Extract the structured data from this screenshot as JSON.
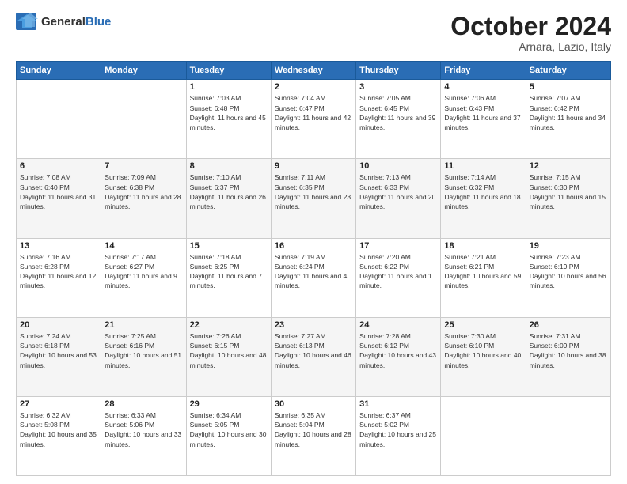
{
  "logo": {
    "line1": "General",
    "line2": "Blue"
  },
  "title": "October 2024",
  "subtitle": "Arnara, Lazio, Italy",
  "days_of_week": [
    "Sunday",
    "Monday",
    "Tuesday",
    "Wednesday",
    "Thursday",
    "Friday",
    "Saturday"
  ],
  "weeks": [
    [
      {
        "day": "",
        "info": ""
      },
      {
        "day": "",
        "info": ""
      },
      {
        "day": "1",
        "info": "Sunrise: 7:03 AM\nSunset: 6:48 PM\nDaylight: 11 hours and 45 minutes."
      },
      {
        "day": "2",
        "info": "Sunrise: 7:04 AM\nSunset: 6:47 PM\nDaylight: 11 hours and 42 minutes."
      },
      {
        "day": "3",
        "info": "Sunrise: 7:05 AM\nSunset: 6:45 PM\nDaylight: 11 hours and 39 minutes."
      },
      {
        "day": "4",
        "info": "Sunrise: 7:06 AM\nSunset: 6:43 PM\nDaylight: 11 hours and 37 minutes."
      },
      {
        "day": "5",
        "info": "Sunrise: 7:07 AM\nSunset: 6:42 PM\nDaylight: 11 hours and 34 minutes."
      }
    ],
    [
      {
        "day": "6",
        "info": "Sunrise: 7:08 AM\nSunset: 6:40 PM\nDaylight: 11 hours and 31 minutes."
      },
      {
        "day": "7",
        "info": "Sunrise: 7:09 AM\nSunset: 6:38 PM\nDaylight: 11 hours and 28 minutes."
      },
      {
        "day": "8",
        "info": "Sunrise: 7:10 AM\nSunset: 6:37 PM\nDaylight: 11 hours and 26 minutes."
      },
      {
        "day": "9",
        "info": "Sunrise: 7:11 AM\nSunset: 6:35 PM\nDaylight: 11 hours and 23 minutes."
      },
      {
        "day": "10",
        "info": "Sunrise: 7:13 AM\nSunset: 6:33 PM\nDaylight: 11 hours and 20 minutes."
      },
      {
        "day": "11",
        "info": "Sunrise: 7:14 AM\nSunset: 6:32 PM\nDaylight: 11 hours and 18 minutes."
      },
      {
        "day": "12",
        "info": "Sunrise: 7:15 AM\nSunset: 6:30 PM\nDaylight: 11 hours and 15 minutes."
      }
    ],
    [
      {
        "day": "13",
        "info": "Sunrise: 7:16 AM\nSunset: 6:28 PM\nDaylight: 11 hours and 12 minutes."
      },
      {
        "day": "14",
        "info": "Sunrise: 7:17 AM\nSunset: 6:27 PM\nDaylight: 11 hours and 9 minutes."
      },
      {
        "day": "15",
        "info": "Sunrise: 7:18 AM\nSunset: 6:25 PM\nDaylight: 11 hours and 7 minutes."
      },
      {
        "day": "16",
        "info": "Sunrise: 7:19 AM\nSunset: 6:24 PM\nDaylight: 11 hours and 4 minutes."
      },
      {
        "day": "17",
        "info": "Sunrise: 7:20 AM\nSunset: 6:22 PM\nDaylight: 11 hours and 1 minute."
      },
      {
        "day": "18",
        "info": "Sunrise: 7:21 AM\nSunset: 6:21 PM\nDaylight: 10 hours and 59 minutes."
      },
      {
        "day": "19",
        "info": "Sunrise: 7:23 AM\nSunset: 6:19 PM\nDaylight: 10 hours and 56 minutes."
      }
    ],
    [
      {
        "day": "20",
        "info": "Sunrise: 7:24 AM\nSunset: 6:18 PM\nDaylight: 10 hours and 53 minutes."
      },
      {
        "day": "21",
        "info": "Sunrise: 7:25 AM\nSunset: 6:16 PM\nDaylight: 10 hours and 51 minutes."
      },
      {
        "day": "22",
        "info": "Sunrise: 7:26 AM\nSunset: 6:15 PM\nDaylight: 10 hours and 48 minutes."
      },
      {
        "day": "23",
        "info": "Sunrise: 7:27 AM\nSunset: 6:13 PM\nDaylight: 10 hours and 46 minutes."
      },
      {
        "day": "24",
        "info": "Sunrise: 7:28 AM\nSunset: 6:12 PM\nDaylight: 10 hours and 43 minutes."
      },
      {
        "day": "25",
        "info": "Sunrise: 7:30 AM\nSunset: 6:10 PM\nDaylight: 10 hours and 40 minutes."
      },
      {
        "day": "26",
        "info": "Sunrise: 7:31 AM\nSunset: 6:09 PM\nDaylight: 10 hours and 38 minutes."
      }
    ],
    [
      {
        "day": "27",
        "info": "Sunrise: 6:32 AM\nSunset: 5:08 PM\nDaylight: 10 hours and 35 minutes."
      },
      {
        "day": "28",
        "info": "Sunrise: 6:33 AM\nSunset: 5:06 PM\nDaylight: 10 hours and 33 minutes."
      },
      {
        "day": "29",
        "info": "Sunrise: 6:34 AM\nSunset: 5:05 PM\nDaylight: 10 hours and 30 minutes."
      },
      {
        "day": "30",
        "info": "Sunrise: 6:35 AM\nSunset: 5:04 PM\nDaylight: 10 hours and 28 minutes."
      },
      {
        "day": "31",
        "info": "Sunrise: 6:37 AM\nSunset: 5:02 PM\nDaylight: 10 hours and 25 minutes."
      },
      {
        "day": "",
        "info": ""
      },
      {
        "day": "",
        "info": ""
      }
    ]
  ]
}
